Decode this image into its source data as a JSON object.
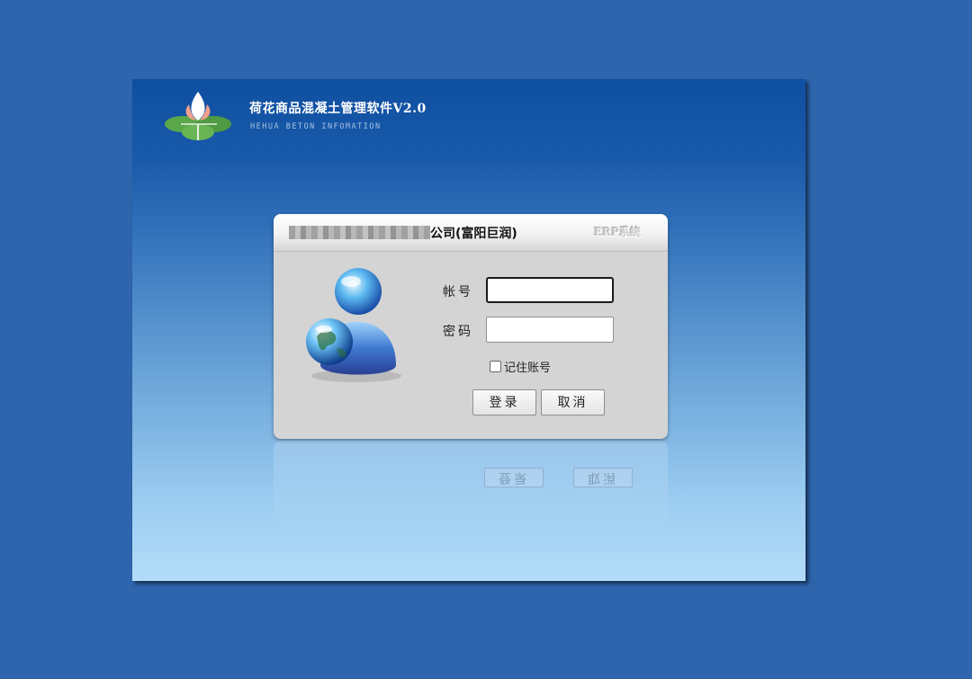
{
  "app": {
    "title": "荷花商品混凝土管理软件V2.0",
    "subtitle": "HEHUA BETON INFOMATION"
  },
  "dialog": {
    "company_name": "公司(富阳巨润)",
    "system_label": "ERP系统"
  },
  "form": {
    "account_label": "帐号",
    "account_value": "",
    "password_label": "密码",
    "password_value": "",
    "remember_label": "记住账号",
    "remember_checked": false,
    "login_label": "登录",
    "cancel_label": "取消"
  },
  "colors": {
    "desktop": "#2e65ad",
    "window_top": "#0f4fa1",
    "window_bottom": "#b3dcf9",
    "dialog": "#d4d4d4"
  },
  "icons": {
    "logo": "lotus-logo-icon",
    "avatar": "user-globe-icon"
  }
}
